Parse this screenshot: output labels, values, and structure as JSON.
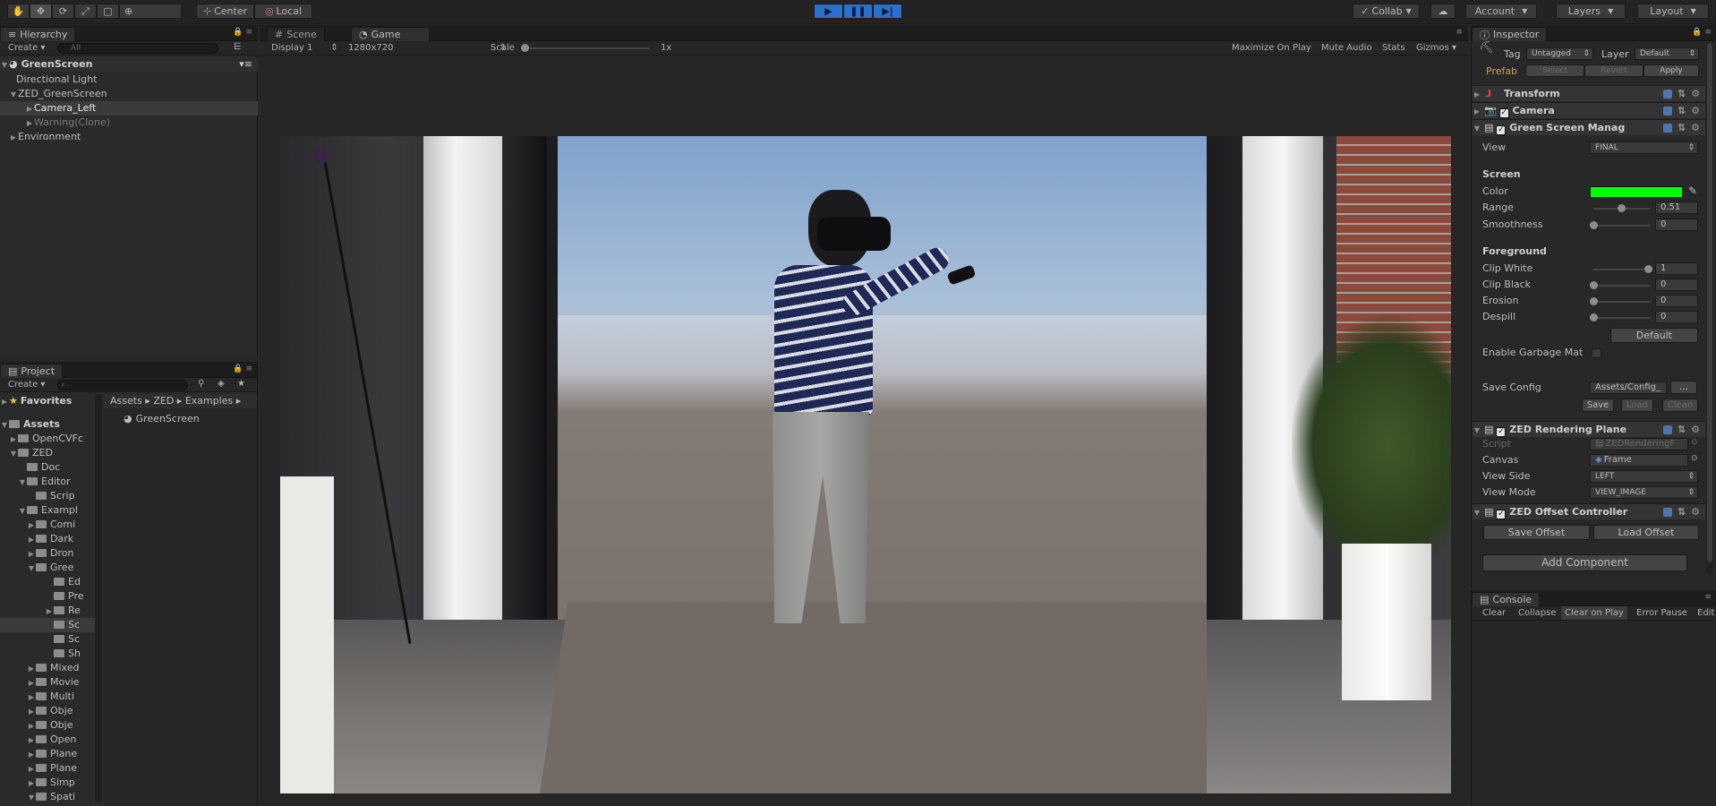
{
  "toolbar": {
    "pivot_center": "Center",
    "pivot_local": "Local",
    "collab": "Collab",
    "account": "Account",
    "layers": "Layers",
    "layout": "Layout"
  },
  "hierarchy": {
    "tab": "Hierarchy",
    "create": "Create",
    "search_placeholder": "All",
    "scene": "GreenScreen",
    "items": [
      {
        "label": "Directional Light"
      },
      {
        "label": "ZED_GreenScreen"
      },
      {
        "label": "Camera_Left"
      },
      {
        "label": "Warning(Clone)"
      },
      {
        "label": "Environment"
      }
    ]
  },
  "scene_game": {
    "tab_scene": "Scene",
    "tab_game": "Game",
    "display": "Display 1",
    "resolution": "1280x720",
    "scale_label": "Scale",
    "scale_value": "1x",
    "maximize": "Maximize On Play",
    "mute": "Mute Audio",
    "stats": "Stats",
    "gizmos": "Gizmos"
  },
  "project": {
    "tab": "Project",
    "create": "Create",
    "favorites": "Favorites",
    "breadcrumb": [
      "Assets",
      "ZED",
      "Examples"
    ],
    "content_item": "GreenScreen",
    "tree": [
      {
        "label": "Assets"
      },
      {
        "label": "OpenCVFc"
      },
      {
        "label": "ZED"
      },
      {
        "label": "Doc"
      },
      {
        "label": "Editor"
      },
      {
        "label": "Scrip"
      },
      {
        "label": "Exampl"
      },
      {
        "label": "Comi"
      },
      {
        "label": "Dark"
      },
      {
        "label": "Dron"
      },
      {
        "label": "Gree"
      },
      {
        "label": "Ed"
      },
      {
        "label": "Pre"
      },
      {
        "label": "Re"
      },
      {
        "label": "Sc"
      },
      {
        "label": "Sc"
      },
      {
        "label": "Sh"
      },
      {
        "label": "Mixed"
      },
      {
        "label": "Movie"
      },
      {
        "label": "Multi"
      },
      {
        "label": "Obje"
      },
      {
        "label": "Obje"
      },
      {
        "label": "Open"
      },
      {
        "label": "Plane"
      },
      {
        "label": "Plane"
      },
      {
        "label": "Simp"
      },
      {
        "label": "Spati"
      }
    ]
  },
  "inspector": {
    "tab": "Inspector",
    "tag_label": "Tag",
    "tag_value": "Untagged",
    "layer_label": "Layer",
    "layer_value": "Default",
    "prefab": "Prefab",
    "select": "Select",
    "revert": "Revert",
    "apply": "Apply",
    "transform": "Transform",
    "camera": "Camera",
    "green_screen": "Green Screen Manag",
    "view_label": "View",
    "view_value": "FINAL",
    "screen_section": "Screen",
    "color_label": "Color",
    "color_value": "#00ff00",
    "range_label": "Range",
    "range_value": "0.51",
    "smoothness_label": "Smoothness",
    "smoothness_value": "0",
    "foreground_section": "Foreground",
    "clip_white_label": "Clip White",
    "clip_white_value": "1",
    "clip_black_label": "Clip Black",
    "clip_black_value": "0",
    "erosion_label": "Erosion",
    "erosion_value": "0",
    "despill_label": "Despill",
    "despill_value": "0",
    "default_btn": "Default",
    "garbage_label": "Enable Garbage Mat",
    "save_config_label": "Save Config",
    "save_config_value": "Assets/Config_",
    "browse_btn": "...",
    "save_btn": "Save",
    "load_btn": "Load",
    "clean_btn": "Clean",
    "zed_rendering": "ZED Rendering Plane",
    "script_label": "Script",
    "script_value": "ZEDRenderingF",
    "canvas_label": "Canvas",
    "canvas_value": "Frame",
    "view_side_label": "View Side",
    "view_side_value": "LEFT",
    "view_mode_label": "View Mode",
    "view_mode_value": "VIEW_IMAGE",
    "zed_offset": "ZED Offset Controller",
    "save_offset": "Save Offset",
    "load_offset": "Load Offset",
    "add_component": "Add Component"
  },
  "console": {
    "tab": "Console",
    "clear": "Clear",
    "collapse": "Collapse",
    "clear_on_play": "Clear on Play",
    "error_pause": "Error Pause",
    "editor": "Edit"
  }
}
